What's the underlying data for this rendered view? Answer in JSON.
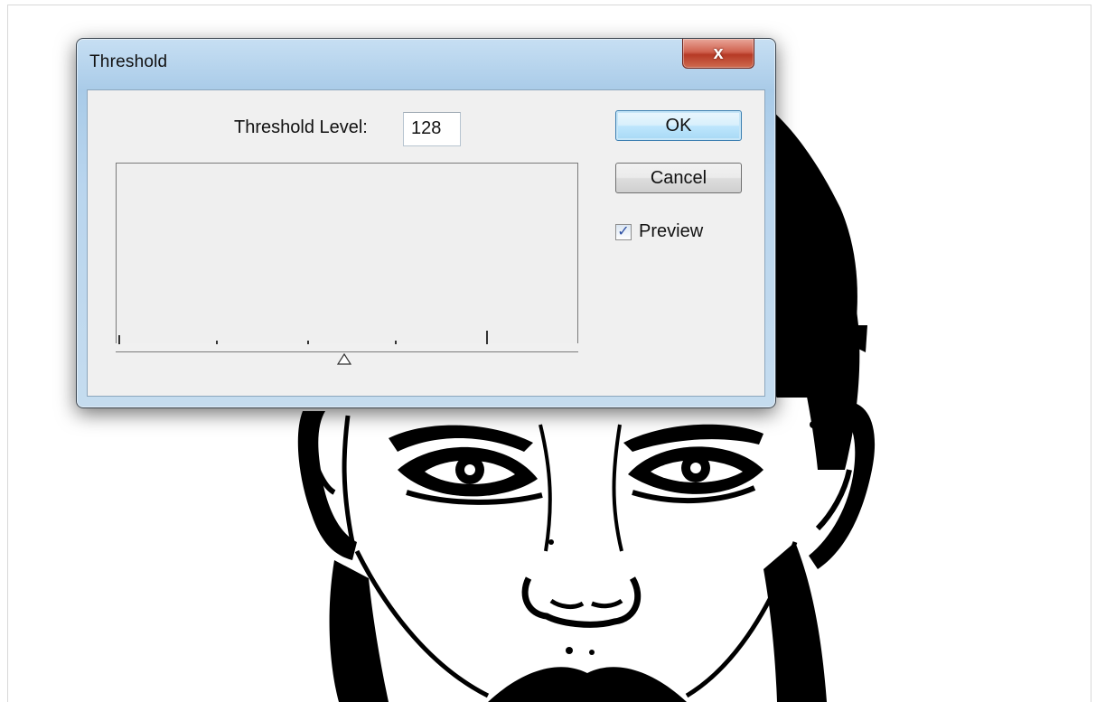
{
  "dialog": {
    "title": "Threshold",
    "close_glyph": "x",
    "threshold_level_label": "Threshold Level:",
    "threshold_level_value": "128",
    "ok_label": "OK",
    "cancel_label": "Cancel",
    "preview_label": "Preview",
    "preview_checked": true,
    "check_glyph": "✓"
  },
  "colors": {
    "titlebar": "#b9d5ee",
    "close_button": "#c74a35",
    "dialog_body": "#f0f0f0",
    "ok_button": "#bee6fd"
  },
  "icons": {
    "close": "close-icon",
    "slider": "triangle-slider-icon",
    "checkbox": "checkmark-icon"
  }
}
